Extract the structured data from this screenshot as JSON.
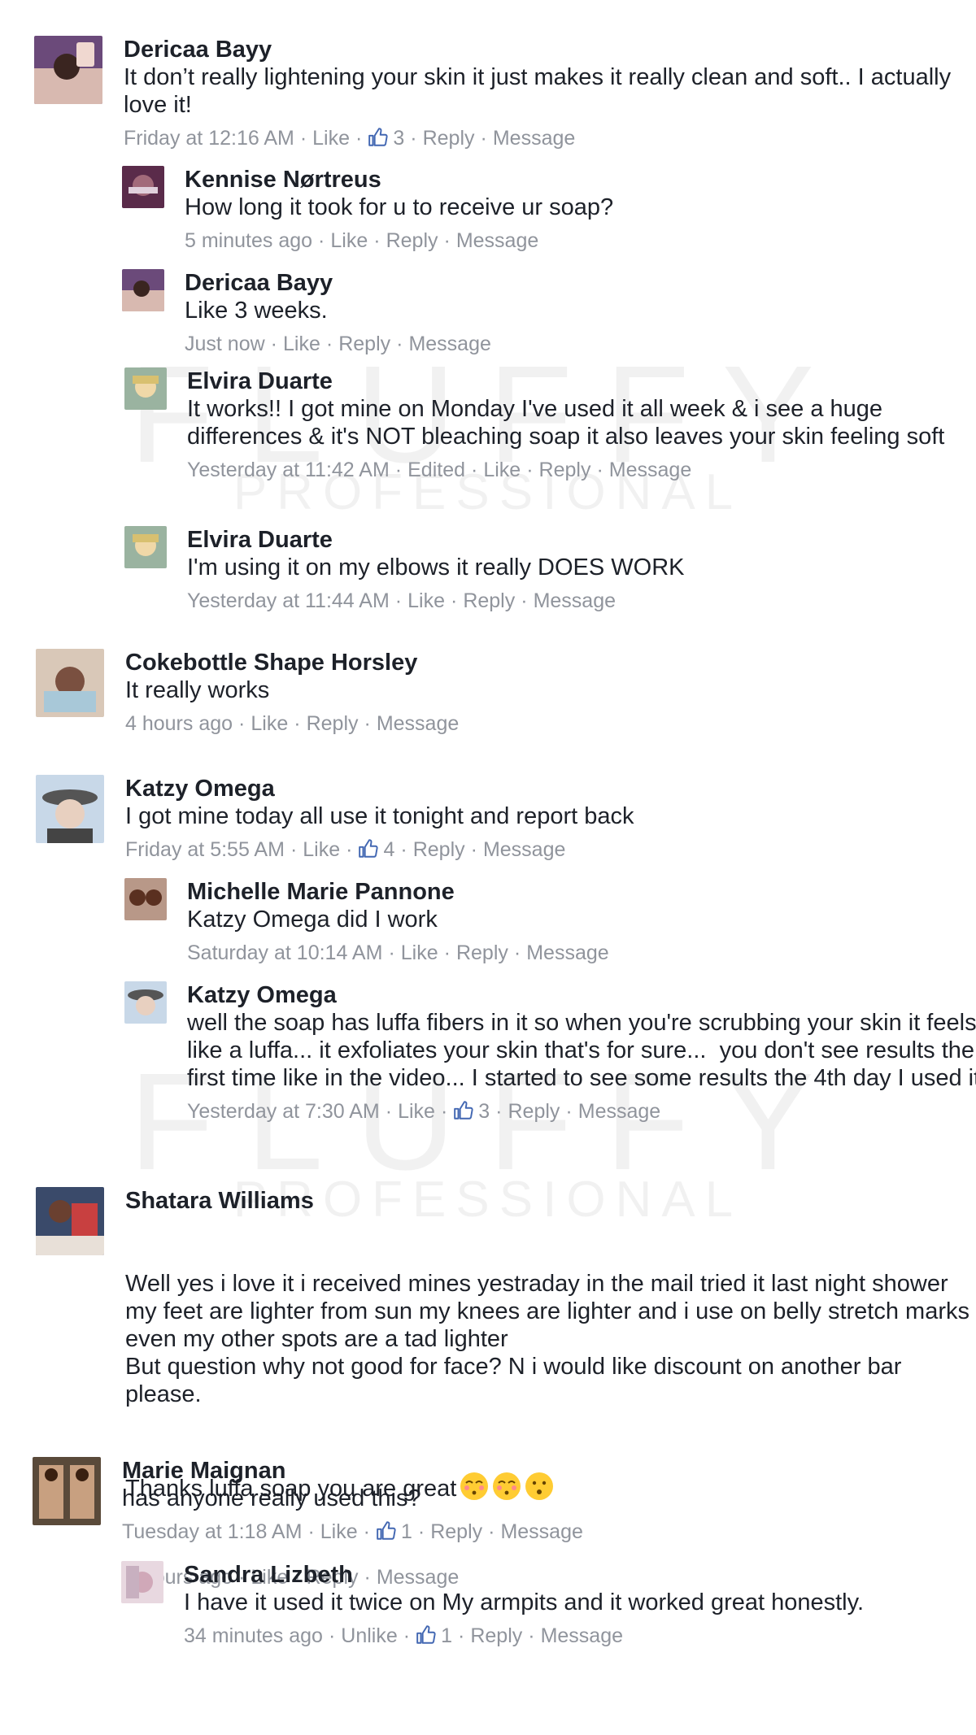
{
  "watermark": {
    "line1": "FLUFFY",
    "line2": "PROFESSIONAL"
  },
  "meta_labels": {
    "like": "Like",
    "unlike": "Unlike",
    "reply": "Reply",
    "message": "Message",
    "edited": "Edited",
    "sep": "·"
  },
  "comments": [
    {
      "name": "Dericaa Bayy",
      "text": "It don’t really lightening your skin it just makes it really clean and soft.. I actually love it!",
      "time": "Friday at 12:16 AM",
      "likes": "3"
    },
    {
      "name": "Kennise Nørtreus",
      "text": "How long it took for u to receive ur soap?",
      "time": "5 minutes ago"
    },
    {
      "name": "Dericaa Bayy",
      "text": "Like 3 weeks.",
      "time": "Just now"
    },
    {
      "name": "Elvira Duarte",
      "text": "It works!! I got mine on Monday I've used it all week & i see a huge differences & it's NOT bleaching soap it also leaves your skin feeling soft",
      "time": "Yesterday at 11:42 AM"
    },
    {
      "name": "Elvira Duarte",
      "text": "I'm using it on my elbows it really DOES WORK",
      "time": "Yesterday at 11:44 AM"
    },
    {
      "name": "Cokebottle Shape Horsley",
      "text": "It really works",
      "time": "4 hours ago"
    },
    {
      "name": "Katzy Omega",
      "text": "I got mine today all use it tonight and report back",
      "time": "Friday at 5:55 AM",
      "likes": "4"
    },
    {
      "name": "Michelle Marie Pannone",
      "text": "Katzy Omega did I work",
      "time": "Saturday at 10:14 AM"
    },
    {
      "name": "Katzy Omega",
      "text": "well the soap has luffa fibers in it so when you're scrubbing your skin it feels like a luffa... it exfoliates your skin that's for sure...  you don't see results the first time like in the video... I started to see some results the 4th day I used it",
      "time": "Yesterday at 7:30 AM",
      "likes": "3"
    },
    {
      "name": "Shatara Williams",
      "text": "Well yes i love it i received mines yestraday in the mail tried it last night shower my feet are lighter from sun my knees are lighter and i use on belly stretch marks even my other spots are a tad lighter\nBut question why not good for face? N i would like discount on another bar please.",
      "text2": "Thanks luffa soap you are great",
      "time": "4 hours ago"
    },
    {
      "name": "Marie Maignan",
      "text": "has anyone really used this?",
      "time": "Tuesday at 1:18 AM",
      "likes": "1"
    },
    {
      "name": "Sandra Lizbeth",
      "text": "I have it used it twice on My armpits and it worked great honestly.",
      "time": "34 minutes ago",
      "likes": "1"
    }
  ],
  "colors": {
    "name": "#1d2129",
    "meta": "#90949c",
    "like_icon": "#4267b2"
  }
}
